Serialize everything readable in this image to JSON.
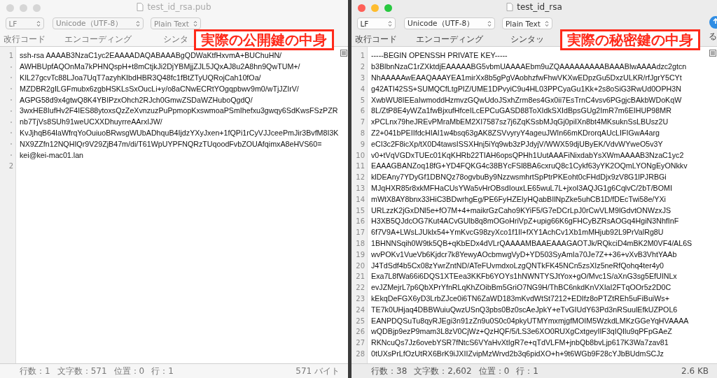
{
  "windows": [
    {
      "title": "test_id_rsa.pub",
      "active": false,
      "toolbar": {
        "popups": [
          "LF",
          "Unicode（UTF-8）",
          "Plain Text"
        ],
        "labels": [
          "改行コード",
          "エンコーディング",
          "シンタ"
        ]
      },
      "overlay_label": "実際の公開鍵の中身",
      "rows": [
        {
          "kind": "line",
          "number": "1",
          "text": "ssh-rsa AAAAB3NzaC1yc2EAAAADAQABAAABgQDWaKtfHxvmA+BUChuHN/"
        },
        {
          "kind": "wrap",
          "text": "AWHBUpfAQOnMa7kPHNQspH+t8mCtjkJi2DjYBMjjZJL5JQxAJ8u2A8hn9QwTUM+/"
        },
        {
          "kind": "wrap",
          "text": "KIL27gcvTc88LJoa7UqT7azyhKIbdHBR3Q48fc1fBtZTyUQRojCah10fOa/"
        },
        {
          "kind": "wrap",
          "text": "MZDBR2gILGFmubx6zgbHSKLsSxOucLi+y/o8aCNwECRtYOgqpbwv9m0/wTjJZIrV/"
        },
        {
          "kind": "wrap",
          "text": "AGPG58d9x4gtwQ8K4YBIPzxOhch2RJch0GmwZSDaWZHuboQgdQ/"
        },
        {
          "kind": "wrap",
          "text": "3wxHE8IufHv2F4IES88ytoxsQzZeXvnzuzPuPpmopKxswmoaPSmIhefxu3gwqy6SdKwsFSzPZR"
        },
        {
          "kind": "wrap",
          "text": "nb7TjVs8SUh91weUCXXDhuyrreAArxIJW/"
        },
        {
          "kind": "wrap",
          "text": "KvJjhqB64IaWfrqYoOuiuoBRwsgWUbADhquB4IjdzYXyJxen+1fQPi1rCyVJJceePmJir3BvfM8I3K"
        },
        {
          "kind": "wrap",
          "text": "NX9ZZfn12NQHIQr9V29ZjB47m/di/T61WpUYPFNQRzTUqoodFvbZOUAfqimxA8eHVS60="
        },
        {
          "kind": "wrap",
          "text": "kei@kei-mac01.lan"
        },
        {
          "kind": "line",
          "number": "2",
          "text": ""
        }
      ],
      "status": {
        "items": [
          "行数：1",
          "文字数：571",
          "位置：0",
          "行：1"
        ],
        "size": "571 バイト"
      }
    },
    {
      "title": "test_id_rsa",
      "active": true,
      "toolbar": {
        "popups": [
          "LF",
          "Unicode（UTF-8）",
          "Plain Text"
        ],
        "labels": [
          "改行コード",
          "エンコーディング",
          "シンタッ"
        ],
        "trailing_label": "る"
      },
      "overlay_label": "実際の秘密鍵の中身",
      "rows": [
        {
          "kind": "line",
          "number": "1",
          "text": "-----BEGIN OPENSSH PRIVATE KEY-----"
        },
        {
          "kind": "line",
          "number": "2",
          "text": "b3BlbnNzaC1rZXktdjEAAAAABG5vbmUAAAAEbm9uZQAAAAAAAAABAAABlwAAAAdzc2gtcn"
        },
        {
          "kind": "line",
          "number": "3",
          "text": "NhAAAAAwEAAQAAAYEA1mirXx8b5gPgVAobhzfwFhwVKXwEDpzGu5DxzULKR/rfJgrY5CYt"
        },
        {
          "kind": "line",
          "number": "4",
          "text": "g42ATI42SS+SUMQCfLtgPIZ/UME1DPvyiC9u4HL03PPCyaGu1Kk+2s8oSiG3RwUd0OPH3N"
        },
        {
          "kind": "line",
          "number": "5",
          "text": "XwbWU8IEEaIwmoddHzmvzGQwUdoJSxhZrm8es4Gx0ii7EsTrnC4vsv6PGgjcBAkbWDoKqW"
        },
        {
          "kind": "line",
          "number": "6",
          "text": "8L/ZtP8E4yWZa1fwBjxufHfceILcEPCuGASD88ToXIdkSXIdBpsGUg2ImR7m6EIHUP98MR"
        },
        {
          "kind": "line",
          "number": "7",
          "text": "xPCLnx79heJREvPMraMbEM2XI7587sz7j6ZqKSsbMJqGj0piIXn8bt4MKsuknSsLBUsz2U"
        },
        {
          "kind": "line",
          "number": "8",
          "text": "Z2+041bPEIIfdcHIAI1w4bsq63gAK8ZSVvyryY4ageuJWIn66mKDrorqAUcLIFIGwA4arg"
        },
        {
          "kind": "line",
          "number": "9",
          "text": "eCI3c2F8icXp/tX0D4tawsISSXHnj5iYq9wb3zPJdyjV/WWX59djUByEK/VdvWYweO5v3Y"
        },
        {
          "kind": "line",
          "number": "10",
          "text": "v0+tVqVGDxTUEc01KqKHRb22TIAH6opsQPHh1UutAAAFiNixdabYsXWmAAAAB3NzaC1yc2"
        },
        {
          "kind": "line",
          "number": "11",
          "text": "EAAAGBANZoq18fG+YD4FQKG4c38BYcFSl8BA6cxruQ8c1Cykf63yYK2OQmLYONgEyONkkv"
        },
        {
          "kind": "line",
          "number": "12",
          "text": "klDEAny7YDyGf1DBNQz78ogvbuBy9NzzwsmhrtSpPtrPKEoht0cFHdDjx9zV8G1lPJRBGi"
        },
        {
          "kind": "line",
          "number": "13",
          "text": "MJqHXR85r8xkMFHaCUsYWa5vHrOBsdIouxLE65wuL7L+jxoI3AQJG1g6CqlvC/2bT/BOMI"
        },
        {
          "kind": "line",
          "number": "14",
          "text": "mWtX8AY8bnx33HiC3BDwrhgEg/PE6FyHZEIyHQabBIlNpZke5uhCB1D/fDEcTwi58e/YXi"
        },
        {
          "kind": "line",
          "number": "15",
          "text": "URLzzK2jGxDNl5e+fO7M+4+maikrGzCaho9KYiF5/G7eDCrLpJ0rCwVLM9lGdvtONWzxJS"
        },
        {
          "kind": "line",
          "number": "16",
          "text": "H3XB5QJdcOG7Kut4ACvGUlb8q8mOGoHriVpZ+upig66K6gFHCyBZRsAOGq4HgiN3NhfInF"
        },
        {
          "kind": "line",
          "number": "17",
          "text": "6f7V9A+LWsLJUklx54+YmKvcG98zyXco1f1Il+fXY1AchCv1Xb1mMHjub92L9PrValRg8U"
        },
        {
          "kind": "line",
          "number": "18",
          "text": "1BHNNSqih0W9tk5QB+qKbEDx4dVLrQAAAAMBAAEAAAGAOTJk/RQkciD4mBK2M0VF4/AL6S"
        },
        {
          "kind": "line",
          "number": "19",
          "text": "wvPOKv1VueVb6Kjdcr7k8YewyAOcbmwgVyD+YD503SyAmIa70Je7Z++36+vXvB3VhtYAAb"
        },
        {
          "kind": "line",
          "number": "20",
          "text": "J4TdSdf4b5Cx08zYwrZntND/ATeFUvmdxoLzgQNTkFK45NCn5zsXIz5neRfQohq4ter4y0"
        },
        {
          "kind": "line",
          "number": "21",
          "text": "Exa7L8fWa66i6DQS1XTEea3KKFb6YOYs1hNWNTYSJtYox+gO/Mvc1S/aXnG3sg5EfUINLx"
        },
        {
          "kind": "line",
          "number": "22",
          "text": "evJZMejrL7p6QbXPrYfnRLqKhZOibBm5GriO7NG9H/ThBC6nkdKnVXIaI2FTqOOr5z2D0C"
        },
        {
          "kind": "line",
          "number": "23",
          "text": "kEkqDeFGX6yD3LrbZJce0i6TN6ZaWD183mKvdWtSt7212+EDIfz8oPTZtREh5uFiBuiWs+"
        },
        {
          "kind": "line",
          "number": "24",
          "text": "TE7k0UHjaq4DBBWuiuQwzUSnQ3pbs0Bz0scAeJpkY+eTvGIUdY63Pd3nRSuulEfkUZPOL6"
        },
        {
          "kind": "line",
          "number": "25",
          "text": "EANPDQSuTu8qyRJEgi3n91zZn9u0S0c04pkyUTMYmxmjgfMOIM5WzkdLMKzGGeYqHVAAAA"
        },
        {
          "kind": "line",
          "number": "26",
          "text": "wQDBjp9ezP9mam3L8zV0CjWz+QzHQF/5/LS3e6XO0RUXgCxtgeyIIF3qIQIlu9qPFpGAeZ"
        },
        {
          "kind": "line",
          "number": "27",
          "text": "RKNcuQs7Jz6ovebYSR7fNtcS6VYaHvXtIgR7e+qTdVLFM+jnbQb8bvLjp617K3Wa7zav81"
        },
        {
          "kind": "line",
          "number": "28",
          "text": "0tUXsPrLfOzUtRX6BrK9iJXIIZvipMzWrvd2b3q6pidXO+h+9t6WGb9F28cYJbBUdmSCJz"
        }
      ],
      "status": {
        "items": [
          "行数：38",
          "文字数：2,602",
          "位置：0",
          "行：1"
        ],
        "size": "2.6 KB"
      }
    }
  ]
}
